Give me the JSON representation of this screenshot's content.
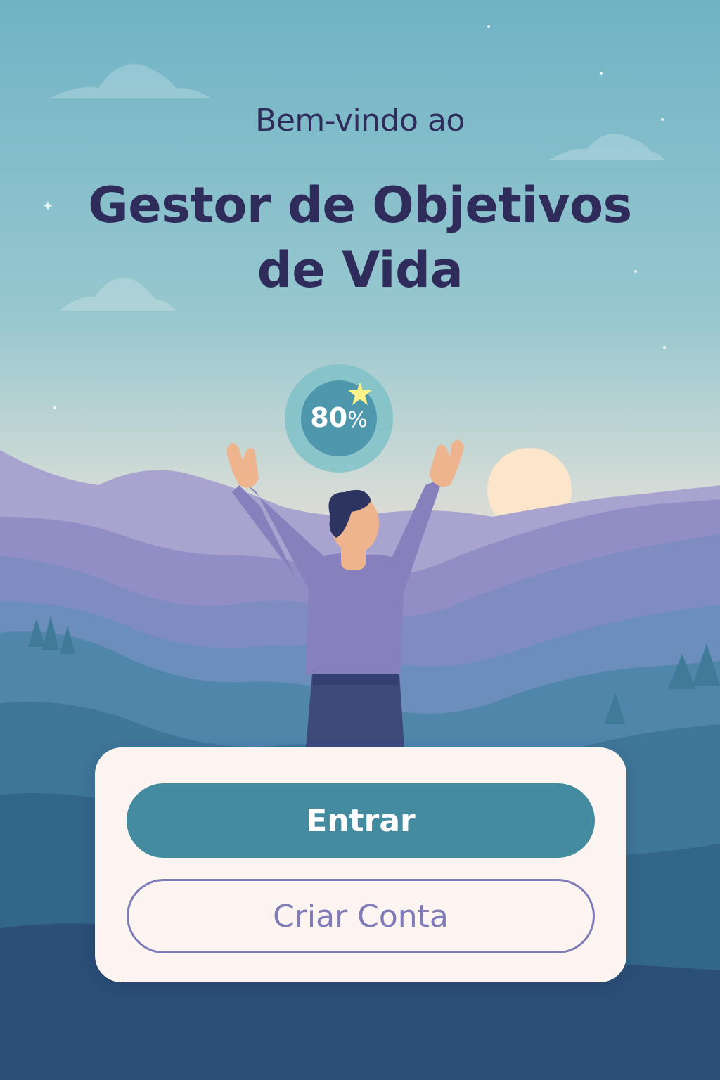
{
  "header": {
    "welcome": "Bem-vindo ao",
    "title_line1": "Gestor de Objetivos",
    "title_line2": "de Vida"
  },
  "progress_badge": {
    "number": "80",
    "unit": "%",
    "value": 0.8
  },
  "actions": {
    "login_label": "Entrar",
    "signup_label": "Criar Conta"
  },
  "colors": {
    "title_text": "#2f2c5c",
    "primary_button": "#448ba0",
    "secondary_button_outline": "#7f7bb8",
    "card_background": "#fbf4f0",
    "sky_top": "#6fb3c5",
    "sky_bottom": "#f3dccf"
  }
}
